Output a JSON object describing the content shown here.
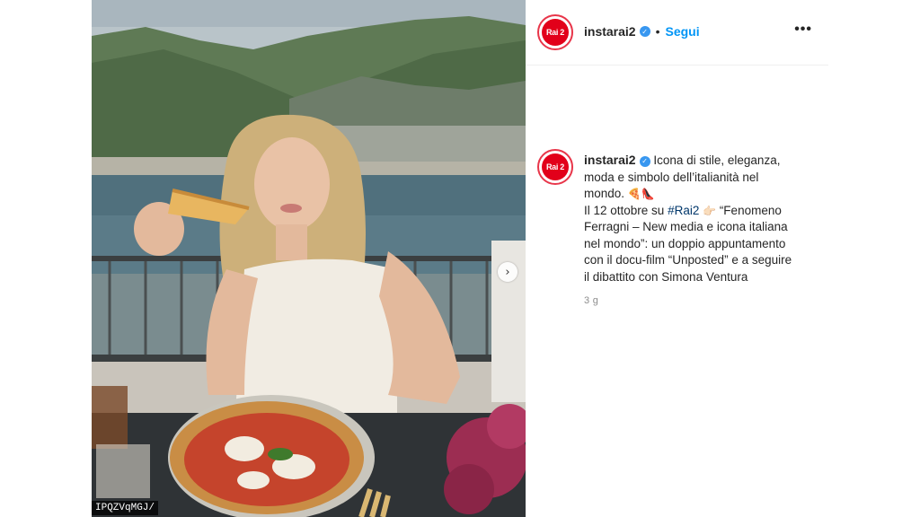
{
  "post": {
    "username": "instarai2",
    "follow_label": "Segui",
    "separator": "•",
    "more_label": "•••",
    "avatar_text": "Rai 2",
    "image_tag": "IPQZVqMGJ/",
    "next_icon": "chevron-right-icon",
    "caption": {
      "line1": "Icona di stile, eleganza,",
      "line2": "moda e simbolo dell’italianità nel",
      "line3": "mondo.",
      "emoji1": "🍕👠",
      "line4_a": "Il 12 ottobre su ",
      "hashtag": "#Rai2",
      "emoji2": "👉🏻",
      "line4_b": " “Fenomeno",
      "line5": "Ferragni – New media e icona italiana",
      "line6": "nel mondo”: un doppio appuntamento",
      "line7": "con il docu-film “Unposted” e a seguire",
      "line8": "il dibattito con Simona Ventura"
    },
    "time": "3 g",
    "colors": {
      "accent": "#0095f6",
      "brand": "#e2001a",
      "verified": "#3897f0"
    }
  }
}
